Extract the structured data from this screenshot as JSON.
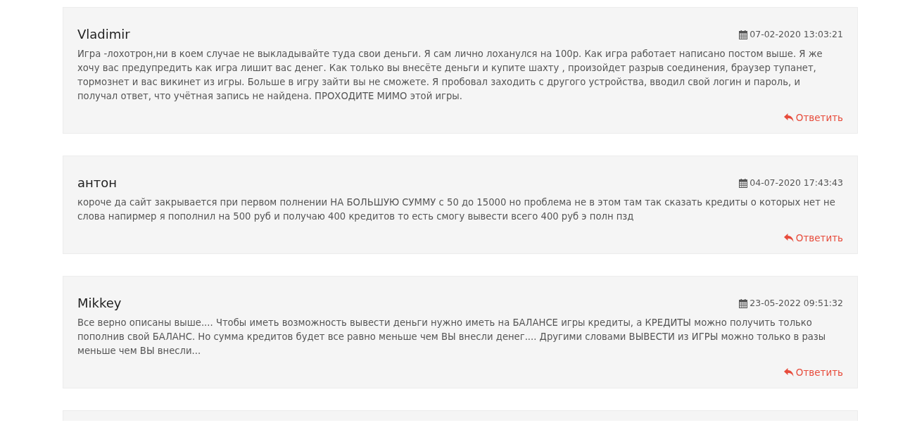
{
  "comments": [
    {
      "author": "Vladimir",
      "date": "07-02-2020 13:03:21",
      "text": "Игра -лохотрон,ни в коем случае не выкладывайте туда свои деньги. Я сам лично лоханулся на 100р. Как игра работает написано постом выше. Я же хочу вас предупредить как игра лишит вас денег. Как только вы внесёте деньги и купите шахту , произойдет разрыв соединения, браузер тупанет, тормознет и вас викинет из игры. Больше в игру зайти вы не сможете. Я пробовал заходить с другого устройства, вводил свой логин и пароль, и получал ответ, что учётная запись не найдена. ПРОХОДИТЕ МИМО этой игры.",
      "reply": "Ответить"
    },
    {
      "author": "антон",
      "date": "04-07-2020 17:43:43",
      "text": "короче да сайт закрывается при первом полнении НА БОЛЬШУЮ СУММУ с 50 до 15000 но проблема не в этом там так сказать кредиты о которых нет не слова напирмер я пополнил на 500 руб и получаю 400 кредитов то есть смогу вывести всего 400 руб э полн пзд",
      "reply": "Ответить"
    },
    {
      "author": "Mikkey",
      "date": "23-05-2022 09:51:32",
      "text": "Все верно описаны выше.... Чтобы иметь возможность вывести деньги нужно иметь на БАЛАНСЕ игры кредиты, а КРЕДИТЫ можно получить только пополнив свой БАЛАНС. Но сумма кредитов будет все равно меньше чем ВЫ внесли денег.... Другими словами ВЫВЕСТИ из ИГРЫ можно только в разы меньше чем ВЫ внесли...",
      "reply": "Ответить"
    }
  ]
}
